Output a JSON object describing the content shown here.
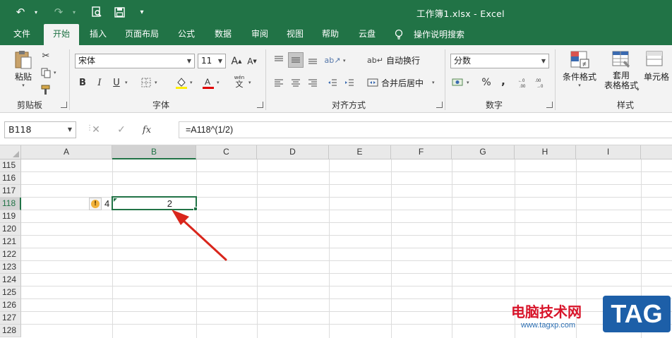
{
  "window": {
    "title": "工作簿1.xlsx  -  Excel"
  },
  "qat": {
    "undo_icon": "undo-icon",
    "redo_icon": "redo-icon",
    "preview_icon": "print-preview-icon",
    "save_icon": "save-icon",
    "more_icon": "customize-qat-icon"
  },
  "tabs": [
    {
      "label": "文件"
    },
    {
      "label": "开始"
    },
    {
      "label": "插入"
    },
    {
      "label": "页面布局"
    },
    {
      "label": "公式"
    },
    {
      "label": "数据"
    },
    {
      "label": "审阅"
    },
    {
      "label": "视图"
    },
    {
      "label": "帮助"
    },
    {
      "label": "云盘"
    }
  ],
  "tell_me": "操作说明搜索",
  "ribbon": {
    "clipboard": {
      "paste": "粘贴",
      "label": "剪贴板"
    },
    "font": {
      "name": "宋体",
      "size": "11",
      "label": "字体",
      "bold": "B",
      "italic": "I",
      "underline": "U",
      "wen": "wén",
      "wen_char": "文"
    },
    "alignment": {
      "wrap": "自动换行",
      "merge": "合并后居中",
      "label": "对齐方式"
    },
    "number": {
      "format": "分数",
      "percent": "%",
      "comma": ",",
      "label": "数字"
    },
    "styles": {
      "cond": "条件格式",
      "table1": "套用",
      "table2": "表格格式",
      "cell": "单元格",
      "label": "样式"
    }
  },
  "formula_bar": {
    "name_box": "B118",
    "formula": "=A118^(1/2)",
    "fx": "fx"
  },
  "grid": {
    "columns": [
      "A",
      "B",
      "C",
      "D",
      "E",
      "F",
      "G",
      "H",
      "I"
    ],
    "rows": [
      "115",
      "116",
      "117",
      "118",
      "119",
      "120",
      "121",
      "122",
      "123",
      "124",
      "125",
      "126",
      "127",
      "128"
    ],
    "cells": {
      "A118": "4",
      "B118": "2"
    }
  },
  "watermark": {
    "text": "电脑技术网",
    "url": "www.tagxp.com",
    "tag": "TAG"
  },
  "colors": {
    "accent": "#217346",
    "arrow": "#d9261c"
  }
}
